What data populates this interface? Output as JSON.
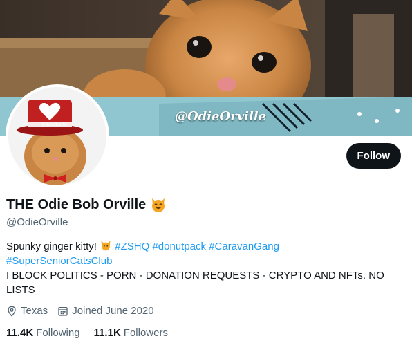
{
  "banner": {
    "caption": "@OdieOrville"
  },
  "avatar": {
    "hat_text": "@OdieOrville"
  },
  "actions": {
    "follow_label": "Follow"
  },
  "profile": {
    "display_name": "THE Odie Bob Orville",
    "handle": "@OdieOrville"
  },
  "bio": {
    "line1_text": "Spunky ginger kitty!",
    "line1_tags": [
      "#ZSHQ",
      "#donutpack",
      "#CaravanGang"
    ],
    "line2_tag": "#SuperSeniorCatsClub",
    "line3": "I BLOCK POLITICS - PORN - DONATION REQUESTS - CRYPTO AND NFTs.  NO",
    "line4": "LISTS"
  },
  "meta": {
    "location": "Texas",
    "location_icon": "location-pin-icon",
    "joined": "Joined June 2020",
    "joined_icon": "calendar-icon"
  },
  "stats": {
    "following_count": "11.4K",
    "following_label": "Following",
    "followers_count": "11.1K",
    "followers_label": "Followers"
  },
  "colors": {
    "link": "#1d9bf0",
    "text": "#0f1419",
    "muted": "#536471",
    "button_bg": "#0f1419"
  }
}
